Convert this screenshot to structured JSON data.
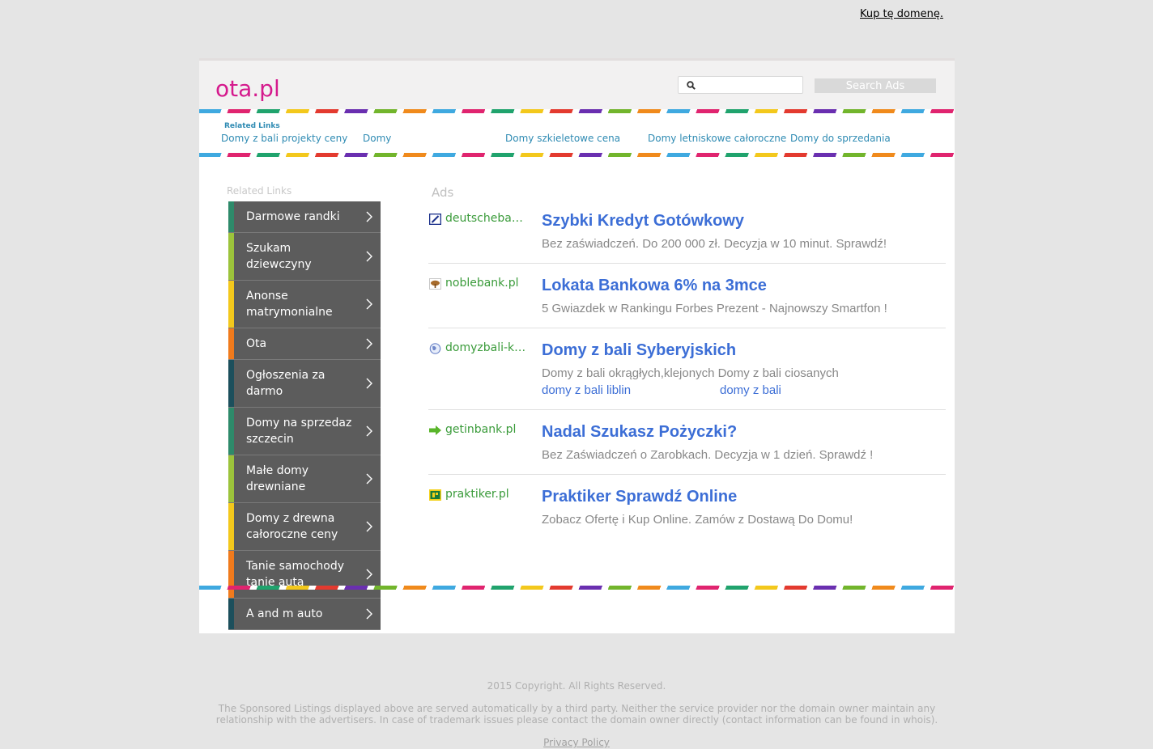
{
  "buy_domain": "Kup tę domenę.",
  "header": {
    "logo": "ota.pl",
    "search_placeholder": "",
    "search_button": "Search Ads"
  },
  "related_top": {
    "title": "Related Links",
    "links": [
      "Domy z bali projekty ceny",
      "Domy",
      "Domy szkieletowe cena",
      "Domy letniskowe całoroczne",
      "Domy do sprzedania"
    ]
  },
  "sidebar": {
    "title": "Related Links",
    "items": [
      {
        "label": "Darmowe randki",
        "color": "#2e8a6a"
      },
      {
        "label": "Szukam dziewczyny",
        "color": "#9cc33b"
      },
      {
        "label": "Anonse matrymonialne",
        "color": "#f3c81c"
      },
      {
        "label": "Ota",
        "color": "#f07a1c"
      },
      {
        "label": "Ogłoszenia za darmo",
        "color": "#1c4f5c"
      },
      {
        "label": "Domy na sprzedaz szczecin",
        "color": "#2e8a6a"
      },
      {
        "label": "Małe domy drewniane",
        "color": "#9cc33b"
      },
      {
        "label": "Domy z drewna całoroczne ceny",
        "color": "#f3c81c"
      },
      {
        "label": "Tanie samochody tanie auta",
        "color": "#f07a1c"
      },
      {
        "label": "A and m auto",
        "color": "#1c4f5c"
      }
    ]
  },
  "ads": {
    "title": "Ads",
    "items": [
      {
        "domain": "deutschebank.pl",
        "icon": "deutsche-bank-icon",
        "title": "Szybki Kredyt Gotówkowy",
        "desc": "Bez zaświadczeń. Do 200 000 zł. Decyzja w 10 minut. Sprawdź!"
      },
      {
        "domain": "noblebank.pl",
        "icon": "tree-icon",
        "title": "Lokata Bankowa 6% na 3mce",
        "desc": "5 Gwiazdek w Rankingu Forbes Prezent - Najnowszy Smartfon !"
      },
      {
        "domain": "domyzbali-krakow.pl",
        "icon": "globe-icon",
        "title": "Domy z bali Syberyjskich",
        "desc": "Domy z bali okrągłych,klejonych Domy z bali ciosanych",
        "sublinks": [
          "domy z bali liblin",
          "domy z bali"
        ]
      },
      {
        "domain": "getinbank.pl",
        "icon": "arrow-icon",
        "title": "Nadal Szukasz Pożyczki?",
        "desc": "Bez Zaświadczeń o Zarobkach. Decyzja w 1 dzień. Sprawdź !"
      },
      {
        "domain": "praktiker.pl",
        "icon": "praktiker-icon",
        "title": "Praktiker Sprawdź Online",
        "desc": "Zobacz Ofertę i Kup Online. Zamów z Dostawą Do Domu!"
      }
    ]
  },
  "footer": {
    "copyright": "2015 Copyright. All Rights Reserved.",
    "disclaimer": "The Sponsored Listings displayed above are served automatically by a third party. Neither the service provider nor the domain owner maintain any relationship with the advertisers. In case of trademark issues please contact the domain owner directly (contact information can be found in whois).",
    "privacy": "Privacy Policy"
  }
}
